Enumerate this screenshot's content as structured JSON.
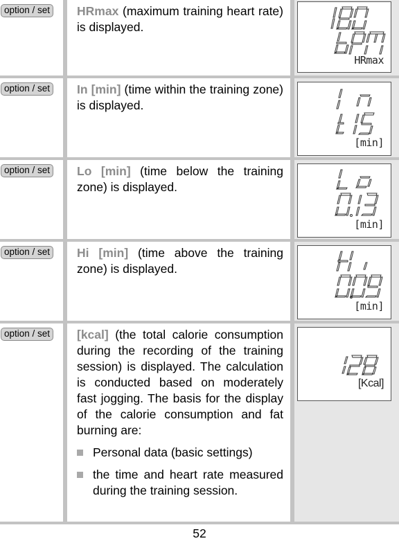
{
  "rows": [
    {
      "button": "option / set",
      "keyword": "HRmax",
      "text": " (maximum training heart rate) is displayed.",
      "display": {
        "line1": "180",
        "line2": "bPM",
        "label": "HRmax"
      }
    },
    {
      "button": "option / set",
      "keyword": "In [min]",
      "text": " (time within the training zone) is displayed.",
      "display": {
        "line1": "In",
        "line2": "t15",
        "label": "[min]"
      }
    },
    {
      "button": "option / set",
      "keyword": "Lo [min]",
      "text": " (time below the training zone) is displayed.",
      "display": {
        "line1": "Lo",
        "line2": "0:13",
        "label": "[min]"
      }
    },
    {
      "button": "option / set",
      "keyword": "Hi [min]",
      "text": " (time above the training zone) is displayed.",
      "display": {
        "line1": "Hi",
        "line2": "0:09",
        "label": "[min]"
      }
    },
    {
      "button": "option / set",
      "keyword": "[kcal]",
      "text": " (the total calorie consumption during the recording of the training session) is displayed. The calculation is conducted based on moderately fast jogging. The basis for the display of the calorie consumption and fat burning are:",
      "bullets": [
        "Personal data (basic settings)",
        "the time and heart rate measured during the training session."
      ],
      "display": {
        "line1": "",
        "line2": "128",
        "label": "[Kcal]"
      }
    }
  ],
  "page_number": "52",
  "colors": {
    "keyword": "#8c8c8c",
    "grid": "#c3c3c3",
    "display_bg": "#e6e6e6",
    "button_bg": "#d4d4d4"
  }
}
